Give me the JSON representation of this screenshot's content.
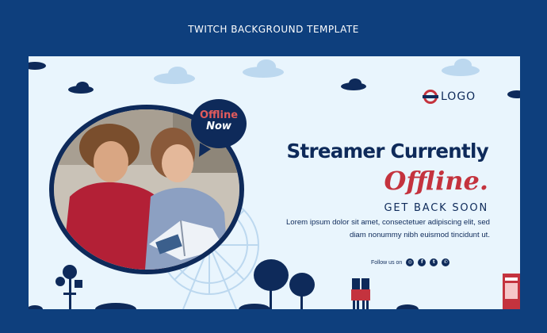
{
  "page": {
    "title": "TWITCH BACKGROUND TEMPLATE"
  },
  "banner": {
    "logo_text": "LOGO",
    "badge": {
      "line1": "Offline",
      "line2": "Now"
    },
    "headline": "Streamer Currently",
    "offline_word": "Offline.",
    "subhead": "GET BACK SOON",
    "body_line1": "Lorem ipsum dolor sit amet, consectetuer adipiscing elit, sed",
    "body_line2": "diam nonummy nibh euismod tincidunt ut.",
    "follow_label": "Follow us on",
    "social_icons": [
      "instagram-icon",
      "facebook-icon",
      "twitter-icon",
      "whatsapp-icon"
    ]
  },
  "colors": {
    "page_bg": "#0e3f7d",
    "banner_bg": "#e9f5fd",
    "navy": "#0e2a5a",
    "accent_red": "#c4333e",
    "cloud_light": "#bcd8ef"
  }
}
